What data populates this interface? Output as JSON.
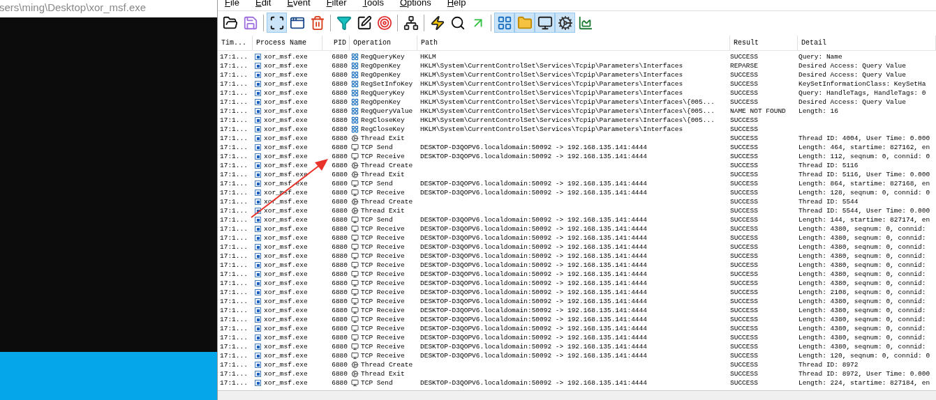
{
  "background_window": {
    "title": "sers\\ming\\Desktop\\xor_msf.exe"
  },
  "menu": [
    "File",
    "Edit",
    "Event",
    "Filter",
    "Tools",
    "Options",
    "Help"
  ],
  "toolbar_groups": [
    [
      {
        "kind": "open",
        "selected": false
      },
      {
        "kind": "save",
        "selected": false
      }
    ],
    [
      {
        "kind": "capture",
        "selected": true
      },
      {
        "kind": "autoscroll",
        "selected": false
      },
      {
        "kind": "clear",
        "selected": false
      }
    ],
    [
      {
        "kind": "filter",
        "selected": false
      },
      {
        "kind": "highlight",
        "selected": false
      },
      {
        "kind": "target",
        "selected": false
      }
    ],
    [
      {
        "kind": "tree",
        "selected": false
      }
    ],
    [
      {
        "kind": "events",
        "selected": false
      },
      {
        "kind": "find",
        "selected": false
      },
      {
        "kind": "jump",
        "selected": false
      }
    ],
    [
      {
        "kind": "registry",
        "selected": true
      },
      {
        "kind": "filesystem",
        "selected": true
      },
      {
        "kind": "network",
        "selected": true
      },
      {
        "kind": "process",
        "selected": true
      },
      {
        "kind": "profiling",
        "selected": false
      }
    ]
  ],
  "table": {
    "columns": [
      "Tim...",
      "Process Name",
      "PID",
      "Operation",
      "Path",
      "Result",
      "Detail"
    ],
    "rows": [
      {
        "time": "17:1...",
        "process": "xor_msf.exe",
        "pid": "6880",
        "kind": "registry",
        "operation": "RegQueryKey",
        "path": "HKLM",
        "result": "SUCCESS",
        "detail": "Query: Name"
      },
      {
        "time": "17:1...",
        "process": "xor_msf.exe",
        "pid": "6880",
        "kind": "registry",
        "operation": "RegOpenKey",
        "path": "HKLM\\System\\CurrentControlSet\\Services\\Tcpip\\Parameters\\Interfaces",
        "result": "REPARSE",
        "detail": "Desired Access: Query Value"
      },
      {
        "time": "17:1...",
        "process": "xor_msf.exe",
        "pid": "6880",
        "kind": "registry",
        "operation": "RegOpenKey",
        "path": "HKLM\\System\\CurrentControlSet\\Services\\Tcpip\\Parameters\\Interfaces",
        "result": "SUCCESS",
        "detail": "Desired Access: Query Value"
      },
      {
        "time": "17:1...",
        "process": "xor_msf.exe",
        "pid": "6880",
        "kind": "registry",
        "operation": "RegSetInfoKey",
        "path": "HKLM\\System\\CurrentControlSet\\Services\\Tcpip\\Parameters\\Interfaces",
        "result": "SUCCESS",
        "detail": "KeySetInformationClass: KeySetHa"
      },
      {
        "time": "17:1...",
        "process": "xor_msf.exe",
        "pid": "6880",
        "kind": "registry",
        "operation": "RegQueryKey",
        "path": "HKLM\\System\\CurrentControlSet\\Services\\Tcpip\\Parameters\\Interfaces",
        "result": "SUCCESS",
        "detail": "Query: HandleTags, HandleTags: 0"
      },
      {
        "time": "17:1...",
        "process": "xor_msf.exe",
        "pid": "6880",
        "kind": "registry",
        "operation": "RegOpenKey",
        "path": "HKLM\\System\\CurrentControlSet\\Services\\Tcpip\\Parameters\\Interfaces\\{005...",
        "result": "SUCCESS",
        "detail": "Desired Access: Query Value"
      },
      {
        "time": "17:1...",
        "process": "xor_msf.exe",
        "pid": "6880",
        "kind": "registry",
        "operation": "RegQueryValue",
        "path": "HKLM\\System\\CurrentControlSet\\Services\\Tcpip\\Parameters\\Interfaces\\{005...",
        "result": "NAME NOT FOUND",
        "detail": "Length: 16"
      },
      {
        "time": "17:1...",
        "process": "xor_msf.exe",
        "pid": "6880",
        "kind": "registry",
        "operation": "RegCloseKey",
        "path": "HKLM\\System\\CurrentControlSet\\Services\\Tcpip\\Parameters\\Interfaces\\{005...",
        "result": "SUCCESS"
      },
      {
        "time": "17:1...",
        "process": "xor_msf.exe",
        "pid": "6880",
        "kind": "registry",
        "operation": "RegCloseKey",
        "path": "HKLM\\System\\CurrentControlSet\\Services\\Tcpip\\Parameters\\Interfaces",
        "result": "SUCCESS"
      },
      {
        "time": "17:1...",
        "process": "xor_msf.exe",
        "pid": "6880",
        "kind": "thread",
        "operation": "Thread Exit",
        "result": "SUCCESS",
        "detail": "Thread ID: 4004, User Time: 0.000"
      },
      {
        "time": "17:1...",
        "process": "xor_msf.exe",
        "pid": "6880",
        "kind": "network",
        "operation": "TCP Send",
        "path": "DESKTOP-D3QOPV6.localdomain:50092 -> 192.168.135.141:4444",
        "result": "SUCCESS",
        "detail": "Length: 464, startime: 827162, en"
      },
      {
        "time": "17:1...",
        "process": "xor_msf.exe",
        "pid": "6880",
        "kind": "network",
        "operation": "TCP Receive",
        "path": "DESKTOP-D3QOPV6.localdomain:50092 -> 192.168.135.141:4444",
        "result": "SUCCESS",
        "detail": "Length: 112, seqnum: 0, connid: 0"
      },
      {
        "time": "17:1...",
        "process": "xor_msf.exe",
        "pid": "6880",
        "kind": "thread",
        "operation": "Thread Create",
        "result": "SUCCESS",
        "detail": "Thread ID: 5116"
      },
      {
        "time": "17:1...",
        "process": "xor_msf.exe",
        "pid": "6880",
        "kind": "thread",
        "operation": "Thread Exit",
        "result": "SUCCESS",
        "detail": "Thread ID: 5116, User Time: 0.000"
      },
      {
        "time": "17:1...",
        "process": "xor_msf.exe",
        "pid": "6880",
        "kind": "network",
        "operation": "TCP Send",
        "path": "DESKTOP-D3QOPV6.localdomain:50092 -> 192.168.135.141:4444",
        "result": "SUCCESS",
        "detail": "Length: 864, startime: 827168, en"
      },
      {
        "time": "17:1...",
        "process": "xor_msf.exe",
        "pid": "6880",
        "kind": "network",
        "operation": "TCP Receive",
        "path": "DESKTOP-D3QOPV6.localdomain:50092 -> 192.168.135.141:4444",
        "result": "SUCCESS",
        "detail": "Length: 128, seqnum: 0, connid: 0"
      },
      {
        "time": "17:1...",
        "process": "xor_msf.exe",
        "pid": "6880",
        "kind": "thread",
        "operation": "Thread Create",
        "result": "SUCCESS",
        "detail": "Thread ID: 5544"
      },
      {
        "time": "17:1...",
        "process": "xor_msf.exe",
        "pid": "6880",
        "kind": "thread",
        "operation": "Thread Exit",
        "result": "SUCCESS",
        "detail": "Thread ID: 5544, User Time: 0.000"
      },
      {
        "time": "17:1...",
        "process": "xor_msf.exe",
        "pid": "6880",
        "kind": "network",
        "operation": "TCP Send",
        "path": "DESKTOP-D3QOPV6.localdomain:50092 -> 192.168.135.141:4444",
        "result": "SUCCESS",
        "detail": "Length: 144, startime: 827174, en"
      },
      {
        "time": "17:1...",
        "process": "xor_msf.exe",
        "pid": "6880",
        "kind": "network",
        "operation": "TCP Receive",
        "path": "DESKTOP-D3QOPV6.localdomain:50092 -> 192.168.135.141:4444",
        "result": "SUCCESS",
        "detail": "Length: 4380, seqnum: 0, connid:"
      },
      {
        "time": "17:1...",
        "process": "xor_msf.exe",
        "pid": "6880",
        "kind": "network",
        "operation": "TCP Receive",
        "path": "DESKTOP-D3QOPV6.localdomain:50092 -> 192.168.135.141:4444",
        "result": "SUCCESS",
        "detail": "Length: 4380, seqnum: 0, connid:"
      },
      {
        "time": "17:1...",
        "process": "xor_msf.exe",
        "pid": "6880",
        "kind": "network",
        "operation": "TCP Receive",
        "path": "DESKTOP-D3QOPV6.localdomain:50092 -> 192.168.135.141:4444",
        "result": "SUCCESS",
        "detail": "Length: 4380, seqnum: 0, connid:"
      },
      {
        "time": "17:1...",
        "process": "xor_msf.exe",
        "pid": "6880",
        "kind": "network",
        "operation": "TCP Receive",
        "path": "DESKTOP-D3QOPV6.localdomain:50092 -> 192.168.135.141:4444",
        "result": "SUCCESS",
        "detail": "Length: 4380, seqnum: 0, connid:"
      },
      {
        "time": "17:1...",
        "process": "xor_msf.exe",
        "pid": "6880",
        "kind": "network",
        "operation": "TCP Receive",
        "path": "DESKTOP-D3QOPV6.localdomain:50092 -> 192.168.135.141:4444",
        "result": "SUCCESS",
        "detail": "Length: 4380, seqnum: 0, connid:"
      },
      {
        "time": "17:1...",
        "process": "xor_msf.exe",
        "pid": "6880",
        "kind": "network",
        "operation": "TCP Receive",
        "path": "DESKTOP-D3QOPV6.localdomain:50092 -> 192.168.135.141:4444",
        "result": "SUCCESS",
        "detail": "Length: 4380, seqnum: 0, connid:"
      },
      {
        "time": "17:1...",
        "process": "xor_msf.exe",
        "pid": "6880",
        "kind": "network",
        "operation": "TCP Receive",
        "path": "DESKTOP-D3QOPV6.localdomain:50092 -> 192.168.135.141:4444",
        "result": "SUCCESS",
        "detail": "Length: 4380, seqnum: 0, connid:"
      },
      {
        "time": "17:1...",
        "process": "xor_msf.exe",
        "pid": "6880",
        "kind": "network",
        "operation": "TCP Receive",
        "path": "DESKTOP-D3QOPV6.localdomain:50092 -> 192.168.135.141:4444",
        "result": "SUCCESS",
        "detail": "Length: 2108, seqnum: 0, connid:"
      },
      {
        "time": "17:1...",
        "process": "xor_msf.exe",
        "pid": "6880",
        "kind": "network",
        "operation": "TCP Receive",
        "path": "DESKTOP-D3QOPV6.localdomain:50092 -> 192.168.135.141:4444",
        "result": "SUCCESS",
        "detail": "Length: 4380, seqnum: 0, connid:"
      },
      {
        "time": "17:1...",
        "process": "xor_msf.exe",
        "pid": "6880",
        "kind": "network",
        "operation": "TCP Receive",
        "path": "DESKTOP-D3QOPV6.localdomain:50092 -> 192.168.135.141:4444",
        "result": "SUCCESS",
        "detail": "Length: 4380, seqnum: 0, connid:"
      },
      {
        "time": "17:1...",
        "process": "xor_msf.exe",
        "pid": "6880",
        "kind": "network",
        "operation": "TCP Receive",
        "path": "DESKTOP-D3QOPV6.localdomain:50092 -> 192.168.135.141:4444",
        "result": "SUCCESS",
        "detail": "Length: 4380, seqnum: 0, connid:"
      },
      {
        "time": "17:1...",
        "process": "xor_msf.exe",
        "pid": "6880",
        "kind": "network",
        "operation": "TCP Receive",
        "path": "DESKTOP-D3QOPV6.localdomain:50092 -> 192.168.135.141:4444",
        "result": "SUCCESS",
        "detail": "Length: 4380, seqnum: 0, connid:"
      },
      {
        "time": "17:1...",
        "process": "xor_msf.exe",
        "pid": "6880",
        "kind": "network",
        "operation": "TCP Receive",
        "path": "DESKTOP-D3QOPV6.localdomain:50092 -> 192.168.135.141:4444",
        "result": "SUCCESS",
        "detail": "Length: 4380, seqnum: 0, connid:"
      },
      {
        "time": "17:1...",
        "process": "xor_msf.exe",
        "pid": "6880",
        "kind": "network",
        "operation": "TCP Receive",
        "path": "DESKTOP-D3QOPV6.localdomain:50092 -> 192.168.135.141:4444",
        "result": "SUCCESS",
        "detail": "Length: 4380, seqnum: 0, connid:"
      },
      {
        "time": "17:1...",
        "process": "xor_msf.exe",
        "pid": "6880",
        "kind": "network",
        "operation": "TCP Receive",
        "path": "DESKTOP-D3QOPV6.localdomain:50092 -> 192.168.135.141:4444",
        "result": "SUCCESS",
        "detail": "Length: 120, seqnum: 0, connid: 0"
      },
      {
        "time": "17:1...",
        "process": "xor_msf.exe",
        "pid": "6880",
        "kind": "thread",
        "operation": "Thread Create",
        "result": "SUCCESS",
        "detail": "Thread ID: 8972"
      },
      {
        "time": "17:1...",
        "process": "xor_msf.exe",
        "pid": "6880",
        "kind": "thread",
        "operation": "Thread Exit",
        "result": "SUCCESS",
        "detail": "Thread ID: 8972, User Time: 0.000"
      },
      {
        "time": "17:1...",
        "process": "xor_msf.exe",
        "pid": "6880",
        "kind": "network",
        "operation": "TCP Send",
        "path": "DESKTOP-D3QOPV6.localdomain:50092 -> 192.168.135.141:4444",
        "result": "SUCCESS",
        "detail": "Length: 224, startime: 827184, en"
      }
    ]
  }
}
